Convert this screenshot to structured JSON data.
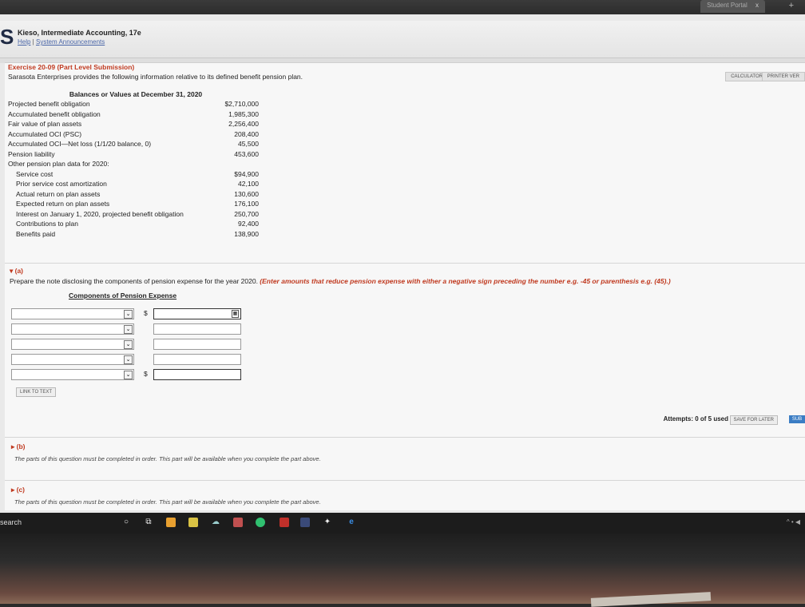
{
  "browser": {
    "tab_label": "Student Portal",
    "tab_close": "x",
    "new_tab": "+"
  },
  "header": {
    "logo": "S",
    "book_title": "Kieso, Intermediate Accounting, 17e",
    "help": "Help",
    "separator": " | ",
    "system_announcements": "System Announcements"
  },
  "exercise": {
    "title": "Exercise 20-09 (Part Level Submission)",
    "intro": "Sarasota Enterprises provides the following information relative to its defined benefit pension plan.",
    "calculator_label": "CALCULATOR",
    "printer_label": "PRINTER VER"
  },
  "balances": {
    "heading": "Balances or Values at December 31, 2020",
    "rows": [
      {
        "label": "Projected benefit obligation",
        "value": "$2,710,000"
      },
      {
        "label": "Accumulated benefit obligation",
        "value": "1,985,300"
      },
      {
        "label": "Fair value of plan assets",
        "value": "2,256,400"
      },
      {
        "label": "Accumulated OCI (PSC)",
        "value": "208,400"
      },
      {
        "label": "Accumulated OCI—Net loss (1/1/20 balance, 0)",
        "value": "45,500"
      },
      {
        "label": "Pension liability",
        "value": "453,600"
      }
    ],
    "other_heading": "Other pension plan data for 2020:",
    "other_rows": [
      {
        "label": "Service cost",
        "value": "$94,900"
      },
      {
        "label": "Prior service cost amortization",
        "value": "42,100"
      },
      {
        "label": "Actual return on plan assets",
        "value": "130,600"
      },
      {
        "label": "Expected return on plan assets",
        "value": "176,100"
      },
      {
        "label": "Interest on January 1, 2020, projected benefit obligation",
        "value": "250,700"
      },
      {
        "label": "Contributions to plan",
        "value": "92,400"
      },
      {
        "label": "Benefits paid",
        "value": "138,900"
      }
    ]
  },
  "part_a": {
    "toggle": "▾ (a)",
    "instruction": "Prepare the note disclosing the components of pension expense for the year 2020. ",
    "instruction_red": "(Enter amounts that reduce pension expense with either a negative sign preceding the number e.g. -45 or parenthesis e.g. (45).)",
    "table_heading": "Components of Pension Expense",
    "dollar_sign": "$",
    "chevron": "⌄",
    "link_to_text": "LINK TO TEXT",
    "attempts": "Attempts: 0 of 5 used",
    "save_for_later": "SAVE FOR LATER",
    "submit": "SUB"
  },
  "part_b": {
    "toggle": "▸ (b)",
    "note": "The parts of this question must be completed in order. This part will be available when you complete the part above."
  },
  "part_c": {
    "toggle": "▸ (c)",
    "note": "The parts of this question must be completed in order. This part will be available when you complete the part above."
  },
  "taskbar": {
    "search": "search",
    "tray": "^ • ◀"
  },
  "icons": {
    "cortana": "circle-icon",
    "task_view": "task-view-icon",
    "chrome": "chrome-icon",
    "file_explorer": "folder-icon",
    "edge": "edge-icon"
  }
}
